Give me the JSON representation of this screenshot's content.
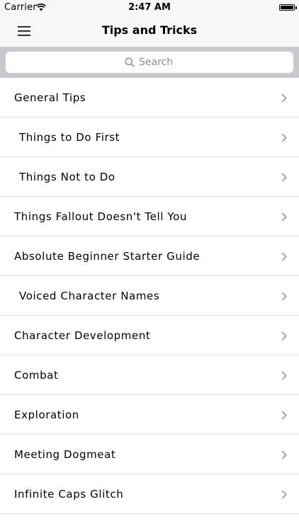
{
  "status_bar": {
    "carrier": "Carrier",
    "time": "2:47 AM",
    "battery_level": 1.0
  },
  "nav_bar": {
    "title": "Tips and Tricks"
  },
  "search": {
    "placeholder": "Search"
  },
  "list": {
    "items": [
      {
        "label": "General Tips",
        "indented": false
      },
      {
        "label": "Things to Do First",
        "indented": true
      },
      {
        "label": "Things Not to Do",
        "indented": true
      },
      {
        "label": "Things Fallout Doesn't Tell You",
        "indented": false
      },
      {
        "label": "Absolute Beginner Starter Guide",
        "indented": false
      },
      {
        "label": "Voiced Character Names",
        "indented": true
      },
      {
        "label": "Character Development",
        "indented": false
      },
      {
        "label": "Combat",
        "indented": false
      },
      {
        "label": "Exploration",
        "indented": false
      },
      {
        "label": "Meeting Dogmeat",
        "indented": false
      },
      {
        "label": "Infinite Caps Glitch",
        "indented": false
      }
    ]
  },
  "colors": {
    "bar_background": "#f7f7f7",
    "search_background": "#c8c8cd",
    "separator": "#e5e5ea",
    "chevron": "#8e8e93",
    "placeholder": "#8e8e93"
  },
  "icons": {
    "menu": "hamburger-menu-icon",
    "search": "magnifier-icon",
    "disclosure": "chevron-right-icon",
    "wifi": "wifi-icon",
    "battery": "battery-icon"
  }
}
